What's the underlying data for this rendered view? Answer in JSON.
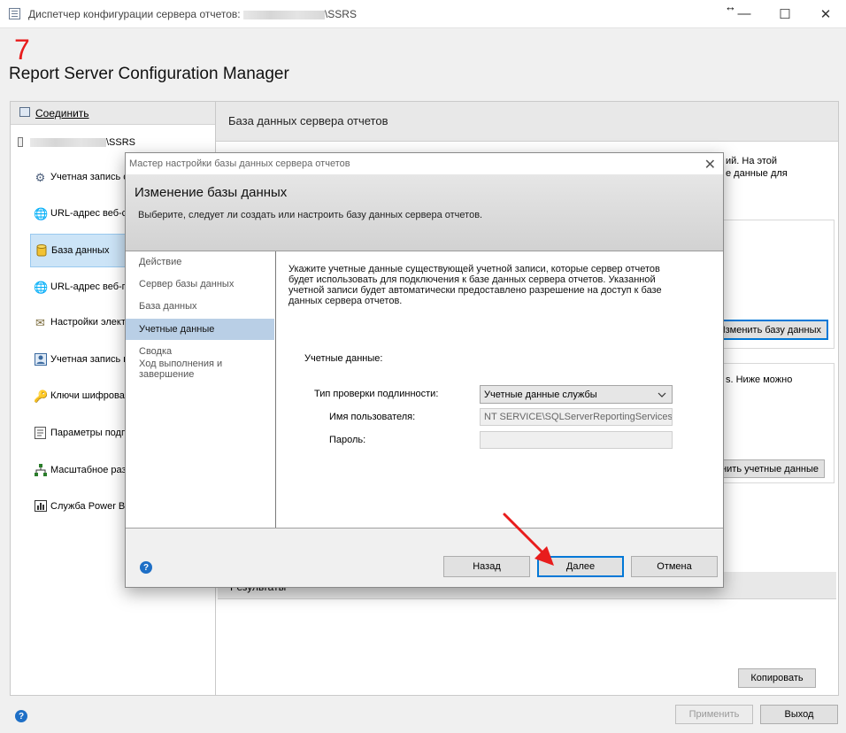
{
  "window": {
    "title_prefix": "Диспетчер конфигурации сервера отчетов:",
    "title_suffix": "\\SSRS",
    "resize_glyph": "↔",
    "minimize": "—",
    "maximize": "☐",
    "close": "✕"
  },
  "badge": "7",
  "app_title": "Report Server Configuration Manager",
  "left": {
    "connect_label": "Соединить",
    "server_suffix": "\\SSRS",
    "items": [
      {
        "label": "Учетная запись с",
        "icon": "service-account-icon"
      },
      {
        "label": "URL-адрес веб-с",
        "icon": "web-url-icon"
      },
      {
        "label": "База данных",
        "icon": "database-icon"
      },
      {
        "label": "URL-адрес веб-п",
        "icon": "web-portal-icon"
      },
      {
        "label": "Настройки элект",
        "icon": "email-icon"
      },
      {
        "label": "Учетная запись в",
        "icon": "execution-account-icon"
      },
      {
        "label": "Ключи шифрован",
        "icon": "key-icon"
      },
      {
        "label": "Параметры подп",
        "icon": "subscription-icon"
      },
      {
        "label": "Масштабное раз",
        "icon": "scale-out-icon"
      },
      {
        "label": "Служба Power BI",
        "icon": "power-bi-icon"
      }
    ]
  },
  "right": {
    "header": "База данных сервера отчетов",
    "bg_text_1": "ий. На этой",
    "bg_text_2": "е данные для",
    "change_db_button": "Изменить базу данных",
    "bg_text_3": "s. Ниже можно",
    "change_creds_button": "нить учетные данные",
    "results_label": "Результаты",
    "copy_button": "Копировать"
  },
  "dialog": {
    "title": "Мастер настройки базы данных сервера отчетов",
    "close": "✕",
    "heading": "Изменение базы данных",
    "subheading": "Выберите, следует ли создать или настроить базу данных сервера отчетов.",
    "steps": [
      "Действие",
      "Сервер базы данных",
      "База данных",
      "Учетные данные",
      "Сводка",
      "Ход выполнения и завершение"
    ],
    "description": "Укажите учетные данные существующей учетной записи, которые сервер отчетов будет использовать для подключения к базе данных сервера отчетов. Указанной учетной записи будет автоматически предоставлено разрешение на доступ к базе данных сервера отчетов.",
    "credentials_label": "Учетные данные:",
    "auth_type_label": "Тип проверки подлинности:",
    "auth_type_value": "Учетные данные службы",
    "username_label": "Имя пользователя:",
    "username_value": "NT SERVICE\\SQLServerReportingServices",
    "password_label": "Пароль:",
    "password_value": "",
    "back_button": "Назад",
    "next_button": "Далее",
    "cancel_button": "Отмена",
    "help": "?"
  },
  "footer": {
    "apply_button": "Применить",
    "exit_button": "Выход",
    "help": "?"
  },
  "colors": {
    "accent": "#0078d7",
    "annotation_red": "#e81c1c",
    "selected_step": "#b9cfe6",
    "selected_nav": "#cce4f7"
  }
}
